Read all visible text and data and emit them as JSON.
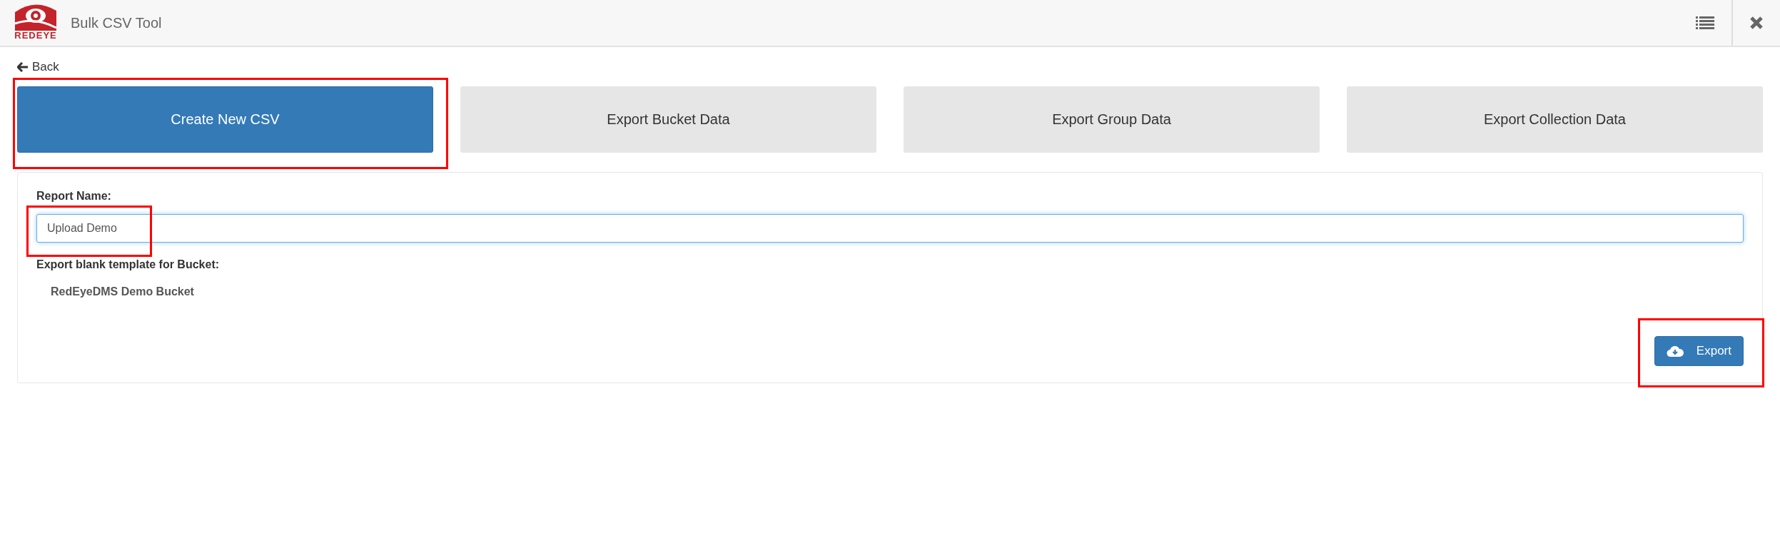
{
  "header": {
    "logo_text": "REDEYE",
    "title": "Bulk CSV Tool"
  },
  "back_link": {
    "label": "Back"
  },
  "tabs": [
    {
      "label": "Create New CSV",
      "selected": true,
      "highlighted": true
    },
    {
      "label": "Export Bucket Data",
      "selected": false,
      "highlighted": false
    },
    {
      "label": "Export Group Data",
      "selected": false,
      "highlighted": false
    },
    {
      "label": "Export Collection Data",
      "selected": false,
      "highlighted": false
    }
  ],
  "form": {
    "report_name_label": "Report Name:",
    "report_name": {
      "value": "Upload Demo",
      "highlighted": true
    },
    "template_label": "Export blank template for Bucket:",
    "bucket_name": "RedEyeDMS Demo Bucket",
    "export_button": {
      "label": "Export",
      "highlighted": true
    }
  }
}
